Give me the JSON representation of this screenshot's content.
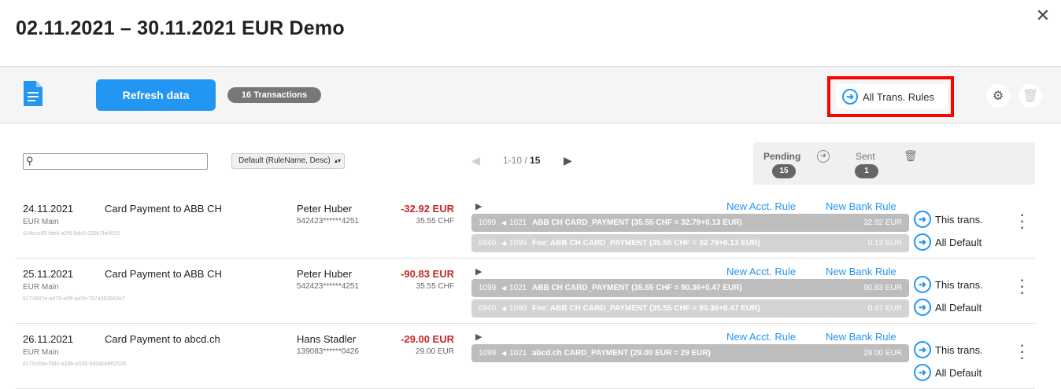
{
  "header": {
    "title": "02.11.2021 – 30.11.2021 EUR Demo",
    "close_icon": "close-icon"
  },
  "toolbar": {
    "doc_icon": "document-icon",
    "refresh_label": "Refresh data",
    "transactions_badge": "16 Transactions",
    "all_rules_label": "All Trans. Rules",
    "settings_icon": "gear-icon",
    "delete_icon": "trash-icon"
  },
  "filters": {
    "search_placeholder": "",
    "sort_value": "Default (RuleName, Desc)"
  },
  "pager": {
    "range": "1-10",
    "total": "15"
  },
  "status": {
    "pending_label": "Pending",
    "pending_count": "15",
    "sent_label": "Sent",
    "sent_count": "1"
  },
  "colors": {
    "accent": "#2196f3",
    "negative": "#c62828",
    "highlight": "#ff0000"
  },
  "transactions": [
    {
      "date": "24.11.2021",
      "account": "EUR Main",
      "id": "614cce85-fde4-a2f5-8dc0-326b7faf4f15",
      "description": "Card Payment to ABB CH",
      "name": "Peter Huber",
      "card": "542423******4251",
      "amount": "-32.92 EUR",
      "original": "35.55 CHF",
      "acct_rule": "New Acct. Rule",
      "bank_rule": "New Bank Rule",
      "this_trans": "This trans.",
      "all_default": "All Default",
      "bookings": [
        {
          "acc1": "1099",
          "acc2": "1021",
          "text": "ABB CH CARD_PAYMENT (35.55 CHF = 32.79+0.13 EUR)",
          "value": "32.92 EUR"
        },
        {
          "acc1": "6940",
          "acc2": "1099",
          "text": "Fee: ABB CH CARD_PAYMENT (35.55 CHF = 32.79+0.13 EUR)",
          "value": "0.13 EUR"
        }
      ]
    },
    {
      "date": "25.11.2021",
      "account": "EUR Main",
      "id": "6174587e-a479-a5ff-aa7e-787a303642e7",
      "description": "Card Payment to ABB CH",
      "name": "Peter Huber",
      "card": "542423******4251",
      "amount": "-90.83 EUR",
      "original": "35.55 CHF",
      "acct_rule": "New Acct. Rule",
      "bank_rule": "New Bank Rule",
      "this_trans": "This trans.",
      "all_default": "All Default",
      "bookings": [
        {
          "acc1": "1099",
          "acc2": "1021",
          "text": "ABB CH CARD_PAYMENT (35.55 CHF = 90.36+0.47 EUR)",
          "value": "90.83 EUR"
        },
        {
          "acc1": "6940",
          "acc2": "1099",
          "text": "Fee: ABB CH CARD_PAYMENT (35.55 CHF = 90.36+0.47 EUR)",
          "value": "0.47 EUR"
        }
      ]
    },
    {
      "date": "26.11.2021",
      "account": "EUR Main",
      "id": "6175c89a-f34c-a2db-a535-5d2ab3862526",
      "description": "Card Payment to abcd.ch",
      "name": "Hans Stadler",
      "card": "139083******0426",
      "amount": "-29.00 EUR",
      "original": "29.00 EUR",
      "acct_rule": "New Acct. Rule",
      "bank_rule": "New Bank Rule",
      "this_trans": "This trans.",
      "all_default": "All Default",
      "bookings": [
        {
          "acc1": "1099",
          "acc2": "1021",
          "text": "abcd.ch CARD_PAYMENT (29.00 EUR = 29 EUR)",
          "value": "29.00 EUR"
        }
      ]
    }
  ]
}
